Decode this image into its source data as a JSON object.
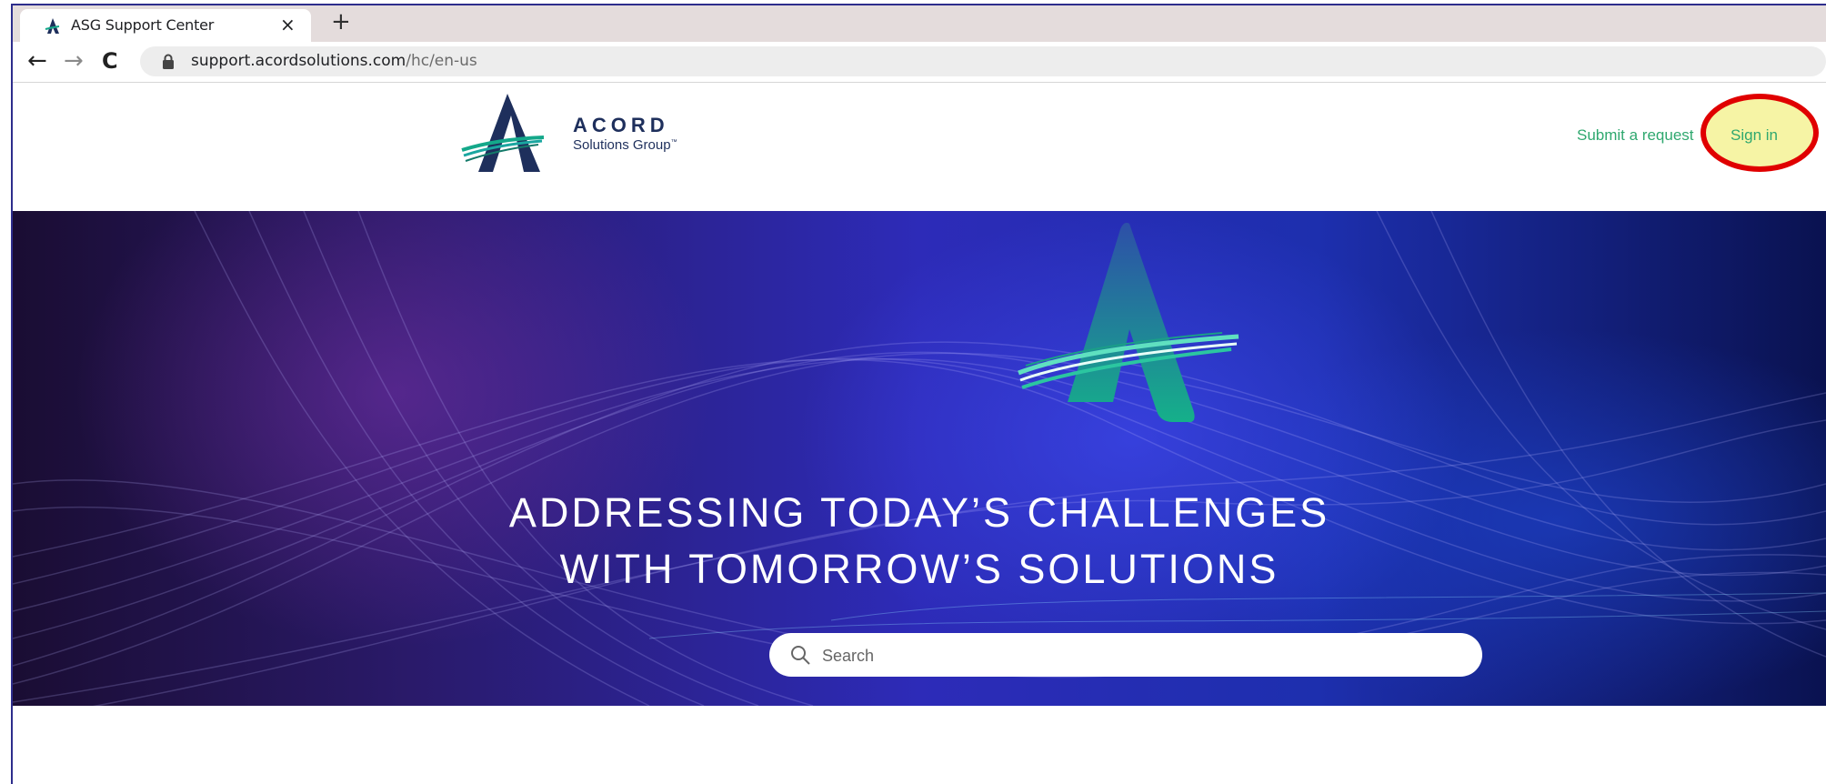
{
  "browser": {
    "tab_title": "ASG Support Center",
    "close_glyph": "×",
    "new_tab_glyph": "+",
    "back_glyph": "←",
    "forward_glyph": "→",
    "reload_glyph": "C",
    "url_host": "support.acordsolutions.com",
    "url_path": "/hc/en-us"
  },
  "header": {
    "logo_word": "ACORD",
    "logo_sub": "Solutions Group",
    "logo_tm": "™",
    "submit_request": "Submit a request",
    "sign_in": "Sign in"
  },
  "hero": {
    "headline_line1": "ADDRESSING TODAY’S CHALLENGES",
    "headline_line2": "WITH TOMORROW’S SOLUTIONS",
    "search_placeholder": "Search"
  },
  "colors": {
    "brand_navy": "#1e2f5c",
    "brand_teal": "#14a88a",
    "link_green": "#2fa86f",
    "highlight_yellow": "#f6f4a5",
    "highlight_red": "#e00000"
  },
  "icons": [
    "acord-favicon-icon",
    "close-icon",
    "plus-icon",
    "back-arrow-icon",
    "forward-arrow-icon",
    "reload-icon",
    "lock-icon",
    "search-icon"
  ]
}
